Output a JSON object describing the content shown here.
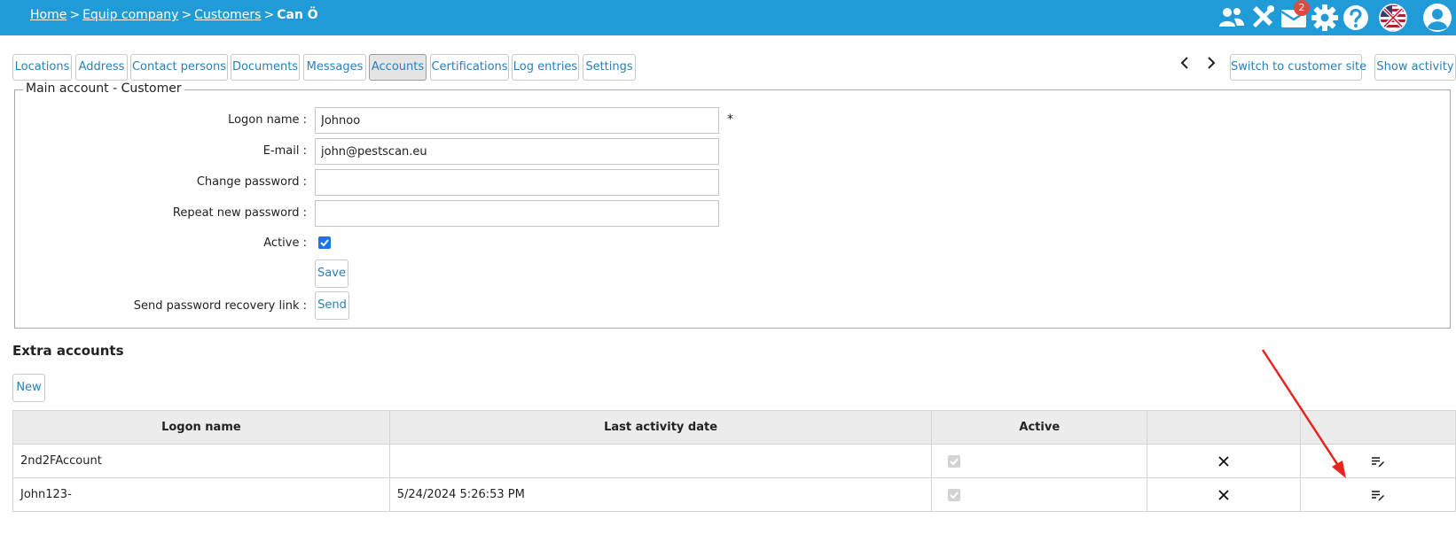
{
  "breadcrumb": {
    "items": [
      "Home",
      "Equip company",
      "Customers"
    ],
    "separator": ">",
    "current": "Can Ö"
  },
  "header": {
    "mail_badge": "2",
    "icons": [
      "users-icon",
      "tools-icon",
      "mail-icon",
      "gear-icon",
      "help-icon",
      "flag-icon",
      "user-avatar-icon"
    ]
  },
  "tabs": [
    {
      "label": "Locations"
    },
    {
      "label": "Address"
    },
    {
      "label": "Contact persons"
    },
    {
      "label": "Documents"
    },
    {
      "label": "Messages"
    },
    {
      "label": "Accounts",
      "active": true
    },
    {
      "label": "Certifications"
    },
    {
      "label": "Log entries"
    },
    {
      "label": "Settings"
    }
  ],
  "right_actions": {
    "switch_label": "Switch to customer site",
    "activity_label": "Show activity"
  },
  "main_account": {
    "legend": "Main account - Customer",
    "logon_label": "Logon name :",
    "logon_value": "Johnoo",
    "required_mark": "*",
    "email_label": "E-mail :",
    "email_value": "john@pestscan.eu",
    "change_pw_label": "Change password :",
    "repeat_pw_label": "Repeat new password :",
    "active_label": "Active :",
    "active_checked": true,
    "save_label": "Save",
    "recovery_label": "Send password recovery link :",
    "send_label": "Send"
  },
  "extra_accounts": {
    "title": "Extra accounts",
    "new_label": "New",
    "columns": [
      "Logon name",
      "Last activity date",
      "Active",
      "",
      ""
    ],
    "rows": [
      {
        "logon": "2nd2FAccount",
        "last_activity": "",
        "active": true
      },
      {
        "logon": "John123-",
        "last_activity": "5/24/2024 5:26:53 PM",
        "active": true
      }
    ]
  },
  "colors": {
    "header_bg": "#219bd7",
    "link": "#2a7fb8",
    "annotation_arrow": "#e8231b"
  }
}
